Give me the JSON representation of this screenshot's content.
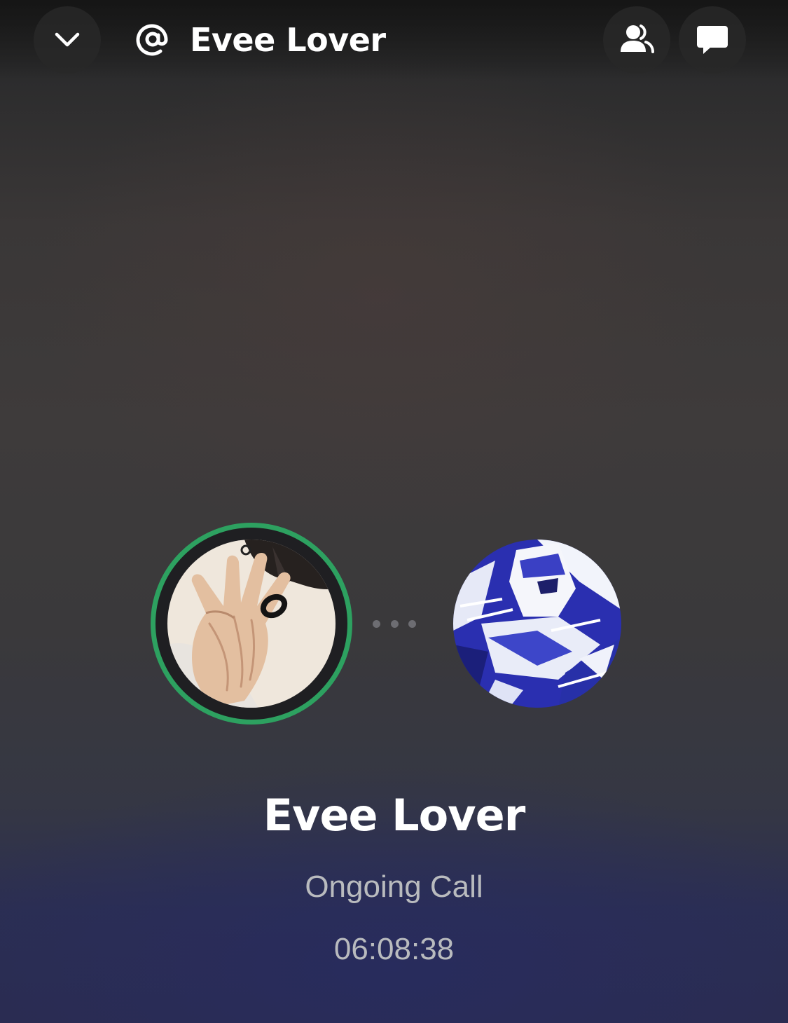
{
  "header": {
    "title": "Evee Lover",
    "collapse_icon": "chevron-down-icon",
    "channel_icon": "at-sign-icon",
    "members_icon": "members-icon",
    "chat_icon": "chat-bubble-icon"
  },
  "call": {
    "callee_name": "Evee Lover",
    "status": "Ongoing Call",
    "timer": "06:08:38",
    "speaking_ring_color": "#2da160"
  },
  "participants": [
    {
      "role": "self",
      "speaking": true,
      "avatar": "hand-with-ring-avatar"
    },
    {
      "role": "other",
      "speaking": false,
      "avatar": "blue-armored-character-avatar"
    }
  ]
}
